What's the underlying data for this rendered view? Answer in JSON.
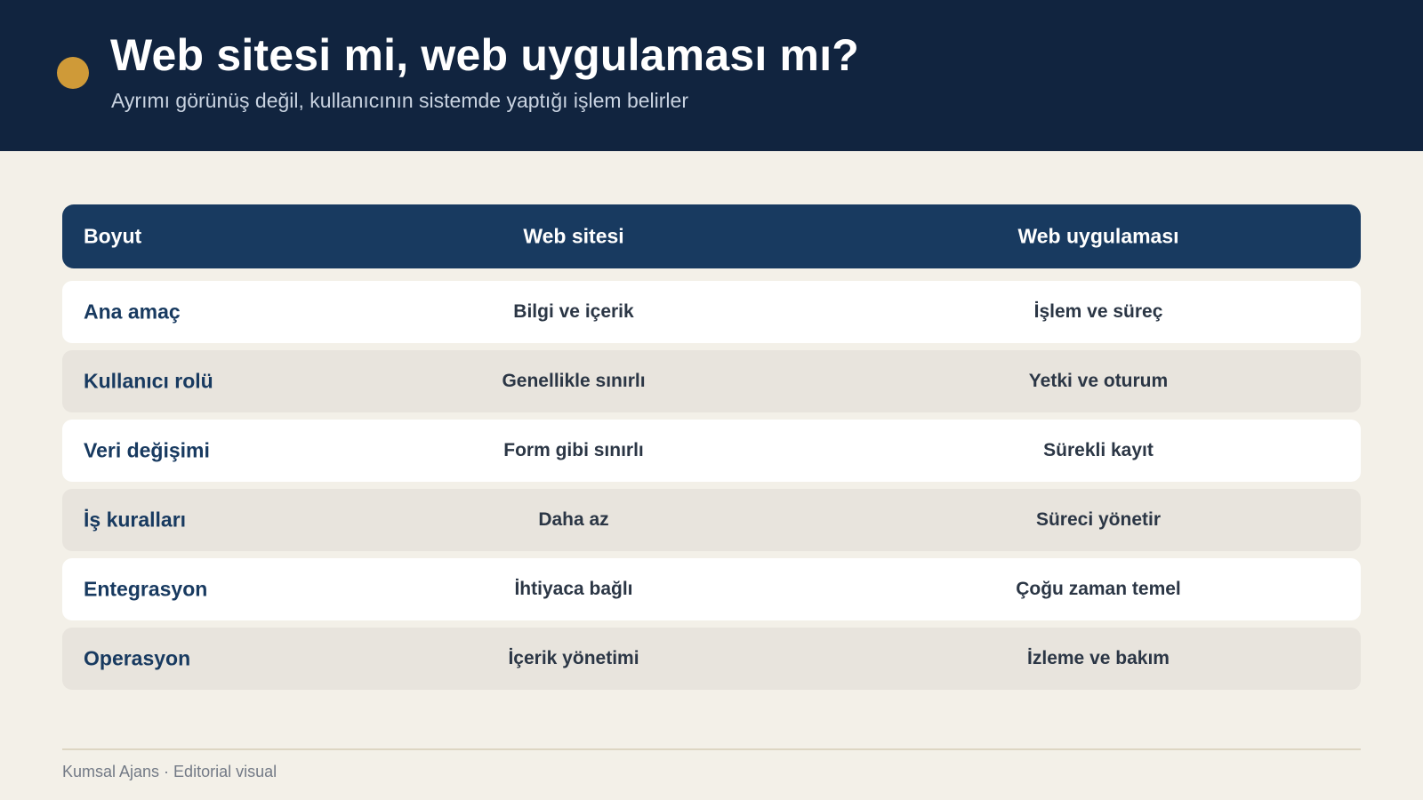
{
  "header": {
    "title": "Web sitesi mi, web uygulaması mı?",
    "subtitle": "Ayrımı görünüş değil, kullanıcının sistemde yaptığı işlem belirler"
  },
  "table": {
    "columns": [
      "Boyut",
      "Web sitesi",
      "Web uygulaması"
    ],
    "rows": [
      [
        "Ana amaç",
        "Bilgi ve içerik",
        "İşlem ve süreç"
      ],
      [
        "Kullanıcı rolü",
        "Genellikle sınırlı",
        "Yetki ve oturum"
      ],
      [
        "Veri değişimi",
        "Form gibi sınırlı",
        "Sürekli kayıt"
      ],
      [
        "İş kuralları",
        "Daha az",
        "Süreci yönetir"
      ],
      [
        "Entegrasyon",
        "İhtiyaca bağlı",
        "Çoğu zaman temel"
      ],
      [
        "Operasyon",
        "İçerik yönetimi",
        "İzleme ve bakım"
      ]
    ]
  },
  "footer": {
    "text": "Kumsal Ajans · Editorial visual"
  },
  "colors": {
    "header_bg": "#11243f",
    "accent": "#cf9a38",
    "table_header_bg": "#183a60",
    "page_bg": "#f3f0e8",
    "row_alt_bg": "#e8e4dd"
  }
}
